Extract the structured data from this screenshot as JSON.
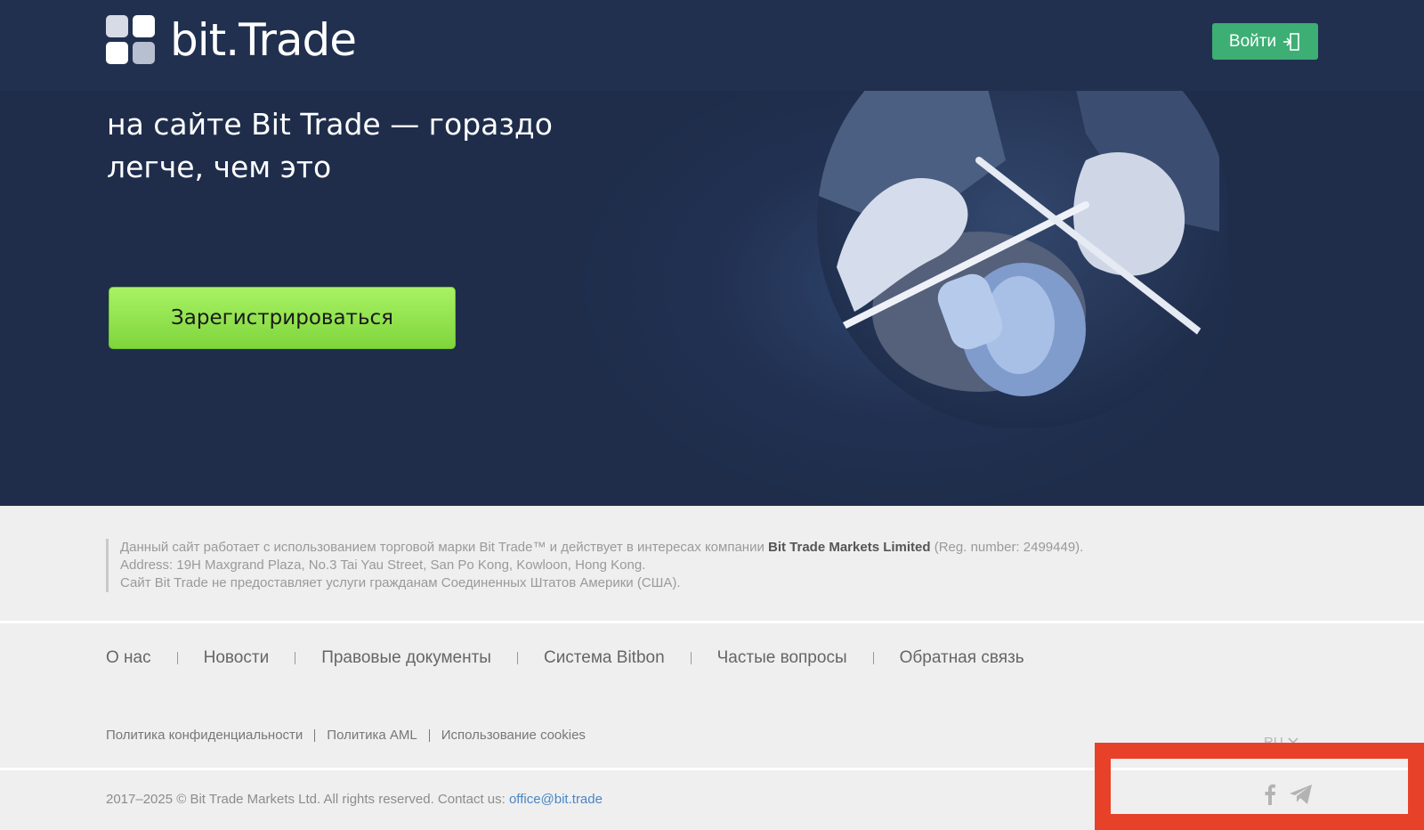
{
  "header": {
    "brand": "bit.Trade",
    "login_label": "Войти"
  },
  "hero": {
    "headline": "на сайте Bit Trade — гораздо легче, чем это",
    "register_label": "Зарегистрироваться"
  },
  "footer": {
    "disclaimer": {
      "line1_pre": "Данный сайт работает с использованием торговой марки Bit Trade™ и действует в интересах компании ",
      "line1_company": "Bit Trade Markets Limited",
      "line1_post": " (Reg. number: 2499449).",
      "line2": "Address: 19H Maxgrand Plaza, No.3 Tai Yau Street, San Po Kong, Kowloon, Hong Kong.",
      "line3": "Сайт Bit Trade не предоставляет услуги гражданам Соединенных Штатов Америки (США)."
    },
    "nav": [
      "О нас",
      "Новости",
      "Правовые документы",
      "Система Bitbon",
      "Частые вопросы",
      "Обратная связь"
    ],
    "legal": [
      "Политика конфиденциальности",
      "Политика AML",
      "Использование cookies"
    ],
    "language": "RU",
    "copyright_text": "2017–2025 © Bit Trade Markets Ltd. All rights reserved. Contact us: ",
    "email": "office@bit.trade",
    "social_icons": [
      "facebook-icon",
      "telegram-icon"
    ]
  },
  "colors": {
    "hero_bg": "#1f2d4b",
    "header_bg": "#21304f",
    "cta_green": "#93e04f",
    "login_green": "#3dae74",
    "link_blue": "#4a86c5",
    "highlight_red": "#e8412a"
  }
}
